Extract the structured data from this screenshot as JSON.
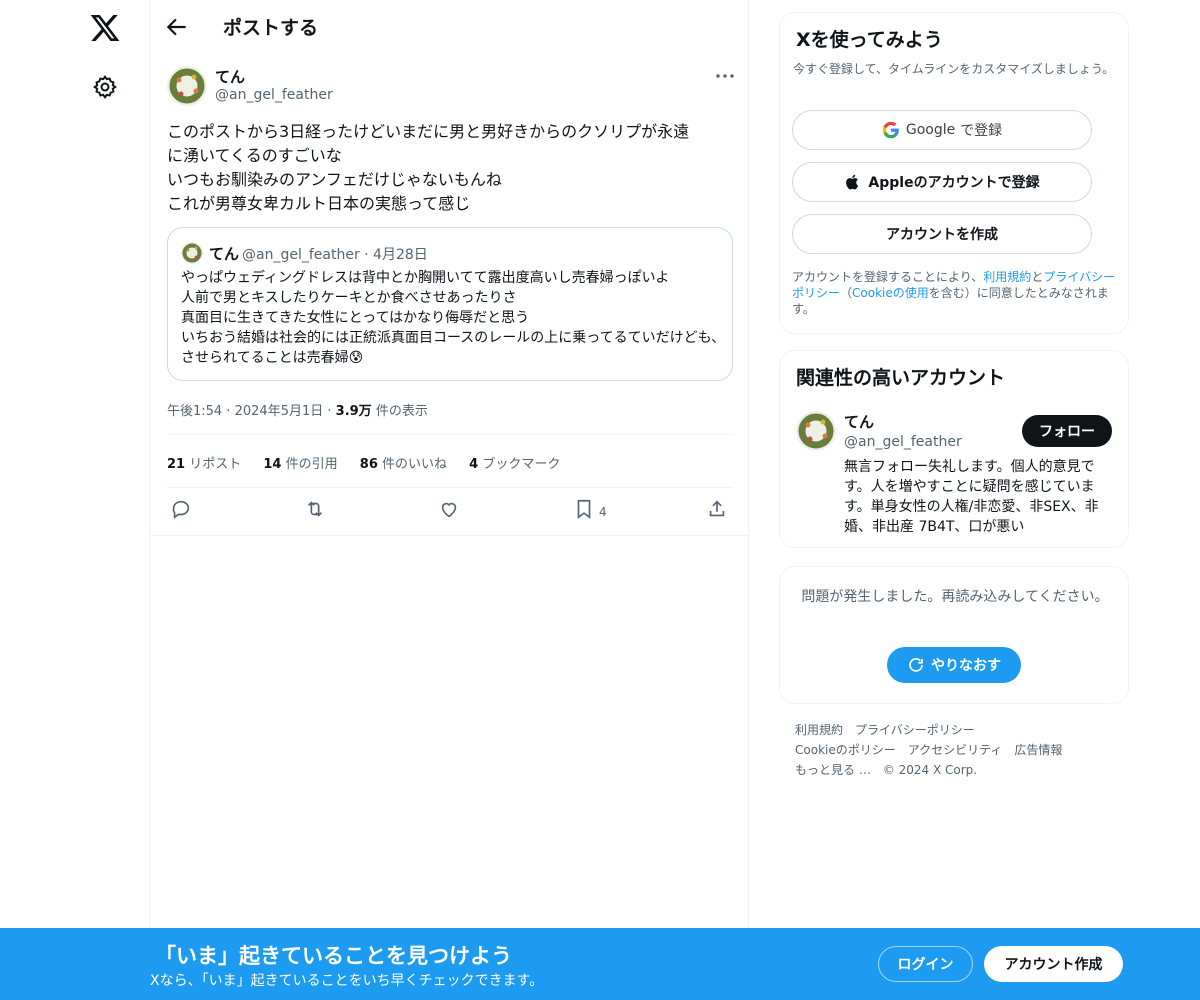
{
  "icons": {
    "logo": "x-logo-icon",
    "settings": "gear-icon",
    "back": "arrow-left-icon",
    "more": "more-horizontal-icon",
    "reply": "reply-icon",
    "repost": "repost-icon",
    "like": "heart-icon",
    "bookmark": "bookmark-icon",
    "share": "share-icon",
    "google": "google-icon",
    "apple": "apple-icon",
    "retry": "refresh-icon"
  },
  "colors": {
    "accent": "#1d9bf0",
    "text": "#0f1419",
    "secondary": "#536471",
    "border": "#cfd9de"
  },
  "header": {
    "title": "ポストする"
  },
  "post": {
    "author_name": "てん",
    "author_handle": "@an_gel_feather",
    "body": "このポストから3日経ったけどいまだに男と男好きからのクソリプが永遠\nに湧いてくるのすごいな\nいつもお馴染みのアンフェだけじゃないもんね\nこれが男尊女卑カルト日本の実態って感じ",
    "quote": {
      "author_name": "てん",
      "author_handle_date": "@an_gel_feather · 4月28日",
      "body": "やっぱウェディングドレスは背中とか胸開いてて露出度高いし売春婦っぽいよ\n人前で男とキスしたりケーキとか食べさせあったりさ\n真面目に生きてきた女性にとってはかなり侮辱だと思う\nいちおう結婚は社会的には正統派真面目コースのレールの上に乗ってるていだけども、させられてることは売春婦😰"
    },
    "time": "午後1:54",
    "date": "2024年5月1日",
    "views_count": "3.9万",
    "views_label": "件の表示",
    "stats": {
      "reposts_count": "21",
      "reposts_label": "リポスト",
      "quotes_count": "14",
      "quotes_label": "件の引用",
      "likes_count": "86",
      "likes_label": "件のいいね",
      "bookmarks_count": "4",
      "bookmarks_label": "ブックマーク"
    },
    "bookmark_action_count": "4"
  },
  "signup": {
    "title": "Xを使ってみよう",
    "subtitle": "今すぐ登録して、タイムラインをカスタマイズしましょう。",
    "google_brand": "Google",
    "google_label": "で登録",
    "apple_label": "Appleのアカウントで登録",
    "create_label": "アカウントを作成",
    "legal_1": "アカウントを登録することにより、",
    "legal_terms": "利用規約",
    "legal_and": "と",
    "legal_privacy": "プライバシーポリシー",
    "legal_2": "（",
    "legal_cookie": "Cookieの使用",
    "legal_3": "を含む）に同意したとみなされます。"
  },
  "related": {
    "title": "関連性の高いアカウント",
    "name": "てん",
    "handle": "@an_gel_feather",
    "follow_label": "フォロー",
    "bio": "無言フォロー失礼します。個人的意見です。人を増やすことに疑問を感じています。単身女性の人権/非恋愛、非SEX、非婚、非出産 7B4T、口が悪い"
  },
  "error": {
    "message": "問題が発生しました。再読み込みしてください。",
    "retry_label": "やりなおす"
  },
  "footer": {
    "terms": "利用規約",
    "privacy": "プライバシーポリシー",
    "cookie": "Cookieのポリシー",
    "accessibility": "アクセシビリティ",
    "ads": "広告情報",
    "more": "もっと見る …",
    "copyright": "© 2024 X Corp."
  },
  "banner": {
    "title": "「いま」起きていることを見つけよう",
    "subtitle": "Xなら、「いま」起きていることをいち早くチェックできます。",
    "login_label": "ログイン",
    "create_label": "アカウント作成"
  }
}
